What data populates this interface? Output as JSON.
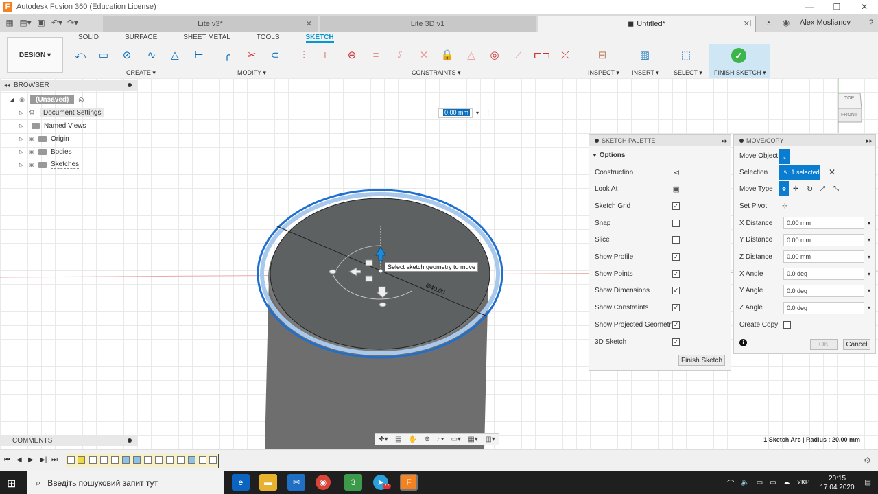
{
  "window": {
    "title": "Autodesk Fusion 360 (Education License)"
  },
  "tabs": [
    {
      "label": "Lite v3*"
    },
    {
      "label": "Lite 3D v1"
    },
    {
      "label": "Untitled*"
    }
  ],
  "user": {
    "name": "Alex Moslianov"
  },
  "workspace_tabs": [
    "SOLID",
    "SURFACE",
    "SHEET METAL",
    "TOOLS",
    "SKETCH"
  ],
  "toolbar": {
    "design_label": "DESIGN ▾",
    "groups": {
      "create": "CREATE ▾",
      "modify": "MODIFY ▾",
      "constraints": "CONSTRAINTS ▾",
      "inspect": "INSPECT ▾",
      "insert": "INSERT ▾",
      "select": "SELECT ▾",
      "finish": "FINISH SKETCH ▾"
    }
  },
  "browser": {
    "title": "BROWSER",
    "root": "(Unsaved)",
    "items": [
      "Document Settings",
      "Named Views",
      "Origin",
      "Bodies",
      "Sketches"
    ]
  },
  "dimension_input": {
    "value": "0.00 mm"
  },
  "tooltip": "Select sketch geometry to move",
  "diameter_label": "Ø40.00",
  "sketch_palette": {
    "title": "SKETCH PALETTE",
    "section": "Options",
    "rows": [
      {
        "label": "Construction",
        "kind": "icon",
        "checked": false
      },
      {
        "label": "Look At",
        "kind": "icon",
        "checked": false
      },
      {
        "label": "Sketch Grid",
        "kind": "check",
        "checked": true
      },
      {
        "label": "Snap",
        "kind": "check",
        "checked": false
      },
      {
        "label": "Slice",
        "kind": "check",
        "checked": false
      },
      {
        "label": "Show Profile",
        "kind": "check",
        "checked": true
      },
      {
        "label": "Show Points",
        "kind": "check",
        "checked": true
      },
      {
        "label": "Show Dimensions",
        "kind": "check",
        "checked": true
      },
      {
        "label": "Show Constraints",
        "kind": "check",
        "checked": true
      },
      {
        "label": "Show Projected Geometries",
        "kind": "check",
        "checked": true
      },
      {
        "label": "3D Sketch",
        "kind": "check",
        "checked": true
      }
    ],
    "finish_button": "Finish Sketch"
  },
  "move_copy": {
    "title": "MOVE/COPY",
    "move_object_label": "Move Object",
    "selection_label": "Selection",
    "selection_value": "1 selected",
    "move_type_label": "Move Type",
    "set_pivot_label": "Set Pivot",
    "fields": [
      {
        "label": "X Distance",
        "value": "0.00 mm"
      },
      {
        "label": "Y Distance",
        "value": "0.00 mm"
      },
      {
        "label": "Z Distance",
        "value": "0.00 mm"
      },
      {
        "label": "X Angle",
        "value": "0.0 deg"
      },
      {
        "label": "Y Angle",
        "value": "0.0 deg"
      },
      {
        "label": "Z Angle",
        "value": "0.0 deg"
      }
    ],
    "create_copy_label": "Create Copy",
    "ok_label": "OK",
    "cancel_label": "Cancel"
  },
  "viewcube": {
    "top": "TOP",
    "front": "FRONT"
  },
  "comments": {
    "title": "COMMENTS"
  },
  "status": "1 Sketch Arc | Radius : 20.00 mm",
  "taskbar": {
    "search_placeholder": "Введіть пошуковий запит тут",
    "language": "УКР",
    "time": "20:15",
    "date": "17.04.2020",
    "telegram_badge": "77"
  },
  "colors": {
    "accent": "#0696d7",
    "selection_blue": "#0a7dd1",
    "finish_green": "#3cb54a"
  }
}
